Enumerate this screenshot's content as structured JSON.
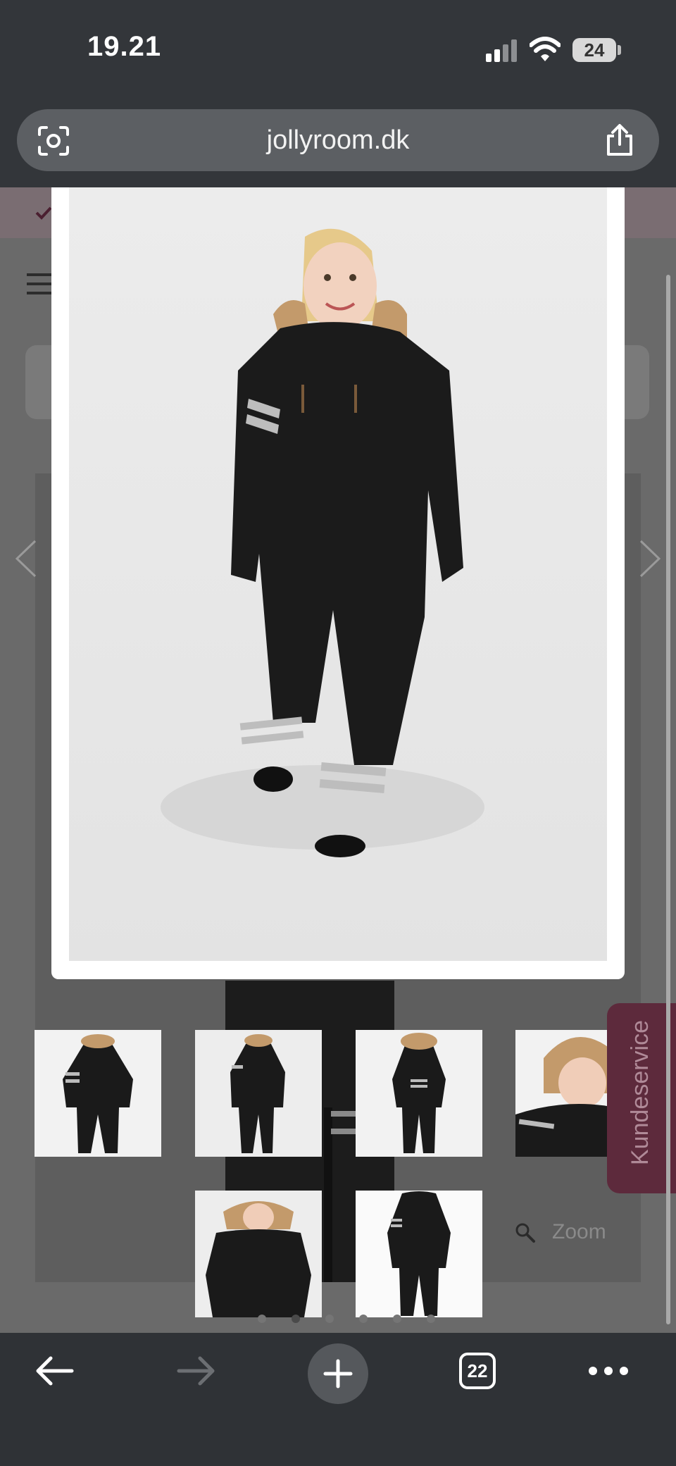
{
  "status_bar": {
    "time": "19.21",
    "battery": "24"
  },
  "browser": {
    "url": "jollyroom.dk",
    "tab_count": "22"
  },
  "page": {
    "side_tab_label": "Kundeservice",
    "zoom_label": "Zoom"
  },
  "gallery": {
    "thumbnails": [
      "Snowsuit front view",
      "Snowsuit walking",
      "Snowsuit back view",
      "Hood close-up",
      "Hood up",
      "Snowsuit flat"
    ],
    "selected_thumbnail": 2
  },
  "icons": {
    "camera": "camera-lens-icon",
    "share": "share-icon",
    "back": "back-arrow-icon",
    "forward": "forward-arrow-icon",
    "new_tab": "plus-icon",
    "tabs": "tabs-icon",
    "more": "more-icon",
    "prev": "chevron-left-icon",
    "next": "chevron-right-icon",
    "zoom": "magnifier-icon"
  },
  "colors": {
    "browser_chrome": "#33363a",
    "url_bar": "#5c5f63",
    "side_tab": "#5d2a3c",
    "suit": "#1b1b1b",
    "fur": "#c39a6b"
  }
}
